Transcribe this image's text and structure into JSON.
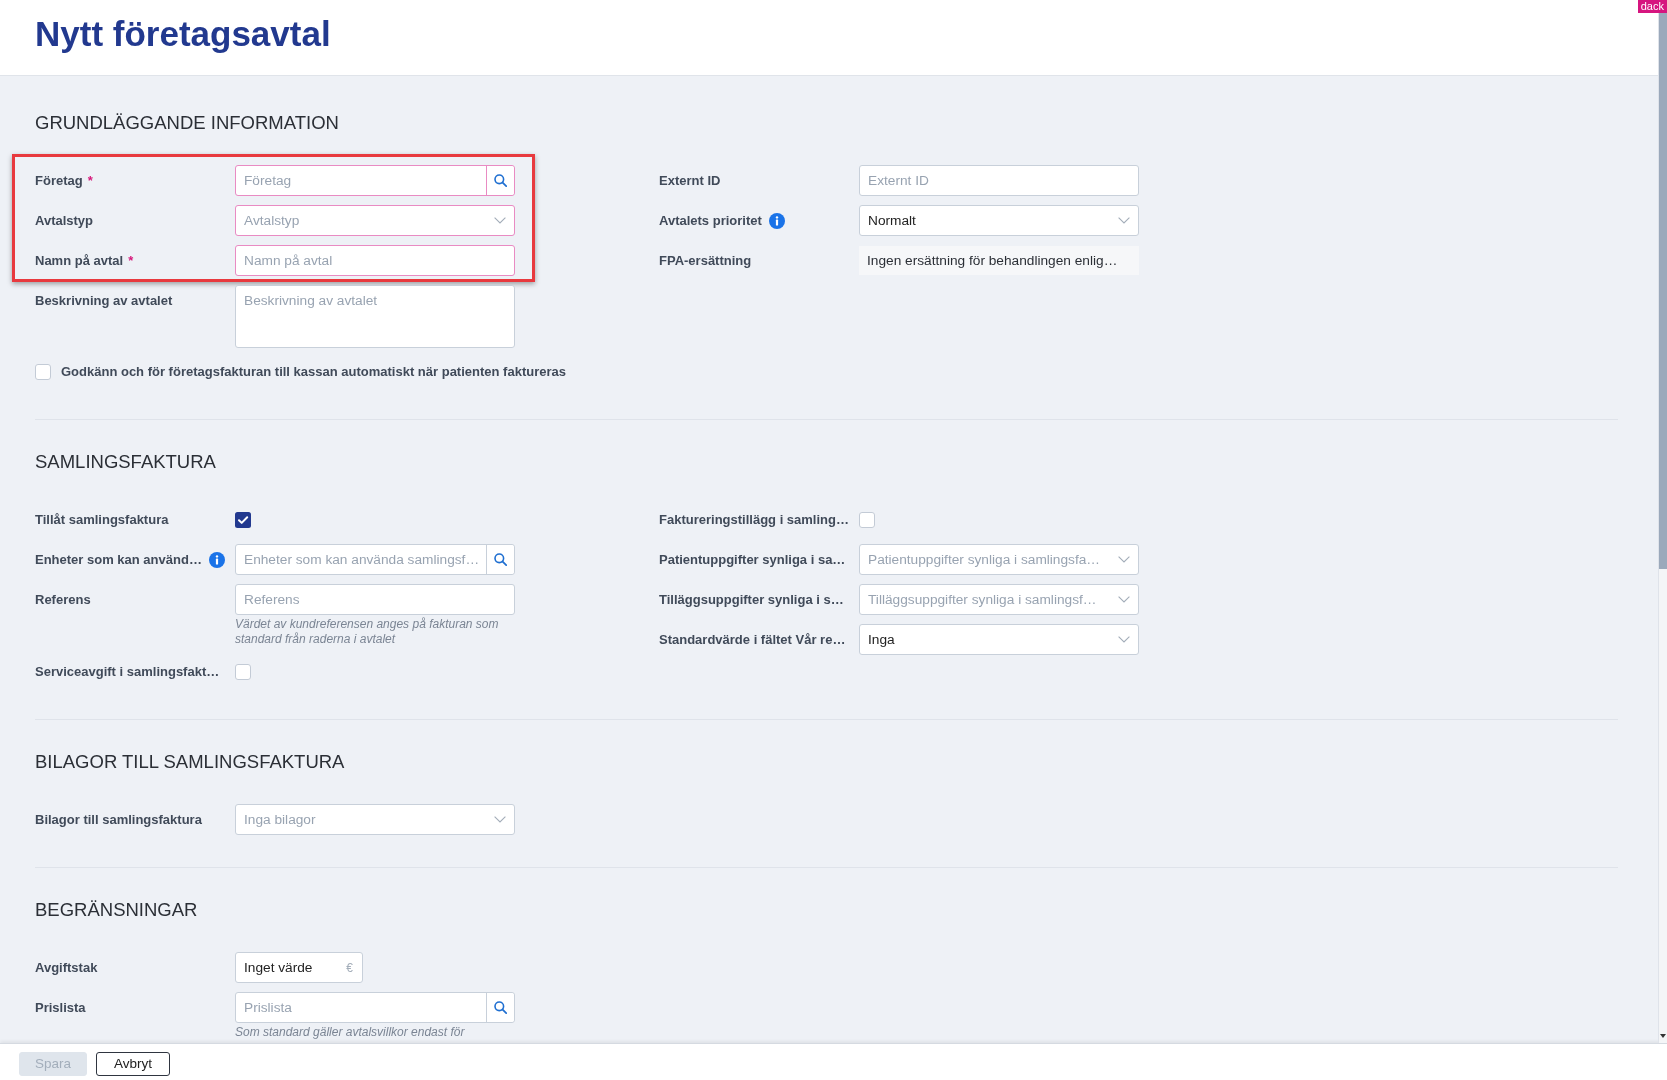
{
  "header": {
    "title": "Nytt företagsavtal",
    "corner_badge": "dack"
  },
  "sections": [
    {
      "title": "GRUNDLÄGGANDE INFORMATION",
      "left_fields": [
        {
          "kind": "search",
          "label": "Företag",
          "required_mark": "*",
          "placeholder": "Företag",
          "invalid": true,
          "highlighted": true
        },
        {
          "kind": "select",
          "label": "Avtalstyp",
          "placeholder": "Avtalstyp",
          "invalid": true,
          "highlighted": true
        },
        {
          "kind": "text",
          "label": "Namn på avtal",
          "required_mark": "*",
          "placeholder": "Namn på avtal",
          "invalid": true,
          "highlighted": true
        },
        {
          "kind": "textarea",
          "label": "Beskrivning av avtalet",
          "placeholder": "Beskrivning av avtalet",
          "invalid": false,
          "highlighted": false
        }
      ],
      "right_fields": [
        {
          "kind": "text",
          "label": "Externt ID",
          "placeholder": "Externt ID",
          "invalid": false
        },
        {
          "kind": "select",
          "label": "Avtalets prioritet",
          "info": true,
          "value": "Normalt",
          "invalid": false
        },
        {
          "kind": "readonly",
          "label": "FPA-ersättning",
          "value": "Ingen ersättning för behandlingen enlig…"
        }
      ],
      "options": [
        {
          "label": "Godkänn och för företagsfakturan till kassan automatiskt när patienten faktureras",
          "checked": false
        }
      ]
    },
    {
      "title": "SAMLINGSFAKTURA",
      "left_fields": [
        {
          "kind": "checkbox",
          "label": "Tillåt samlingsfaktura",
          "checked": true
        },
        {
          "kind": "search",
          "label": "Enheter som kan använd…",
          "info": true,
          "placeholder": "Enheter som kan använda samlingsf…",
          "invalid": false
        },
        {
          "kind": "text",
          "label": "Referens",
          "placeholder": "Referens",
          "hint": "Värdet av kundreferensen anges på fakturan som standard från raderna i avtalet",
          "invalid": false
        },
        {
          "kind": "checkbox",
          "label": "Serviceavgift i samlingsfakt…",
          "checked": false
        }
      ],
      "right_fields": [
        {
          "kind": "checkbox",
          "label": "Faktureringstillägg i samling…",
          "checked": false
        },
        {
          "kind": "select",
          "label": "Patientuppgifter synliga i sa…",
          "placeholder": "Patientuppgifter synliga i samlingsfa…",
          "invalid": false
        },
        {
          "kind": "select",
          "label": "Tilläggsuppgifter synliga i s…",
          "placeholder": "Tilläggsuppgifter synliga i samlingsf…",
          "invalid": false
        },
        {
          "kind": "select",
          "label": "Standardvärde i fältet Vår re…",
          "value": "Inga",
          "invalid": false
        }
      ]
    },
    {
      "title": "BILAGOR TILL SAMLINGSFAKTURA",
      "left_fields": [
        {
          "kind": "select",
          "label": "Bilagor till samlingsfaktura",
          "placeholder": "Inga bilagor",
          "invalid": false
        }
      ]
    },
    {
      "title": "BEGRÄNSNINGAR",
      "left_fields": [
        {
          "kind": "amount",
          "label": "Avgiftstak",
          "value": "Inget värde",
          "suffix": "€",
          "invalid": false
        },
        {
          "kind": "search",
          "label": "Prislista",
          "placeholder": "Prislista",
          "hint": "Som standard gäller avtalsvillkor endast för",
          "invalid": false
        }
      ]
    }
  ],
  "footer": {
    "buttons": [
      {
        "kind": "primary",
        "label": "Spara",
        "disabled": true
      },
      {
        "kind": "secondary",
        "label": "Avbryt",
        "disabled": false
      }
    ]
  }
}
